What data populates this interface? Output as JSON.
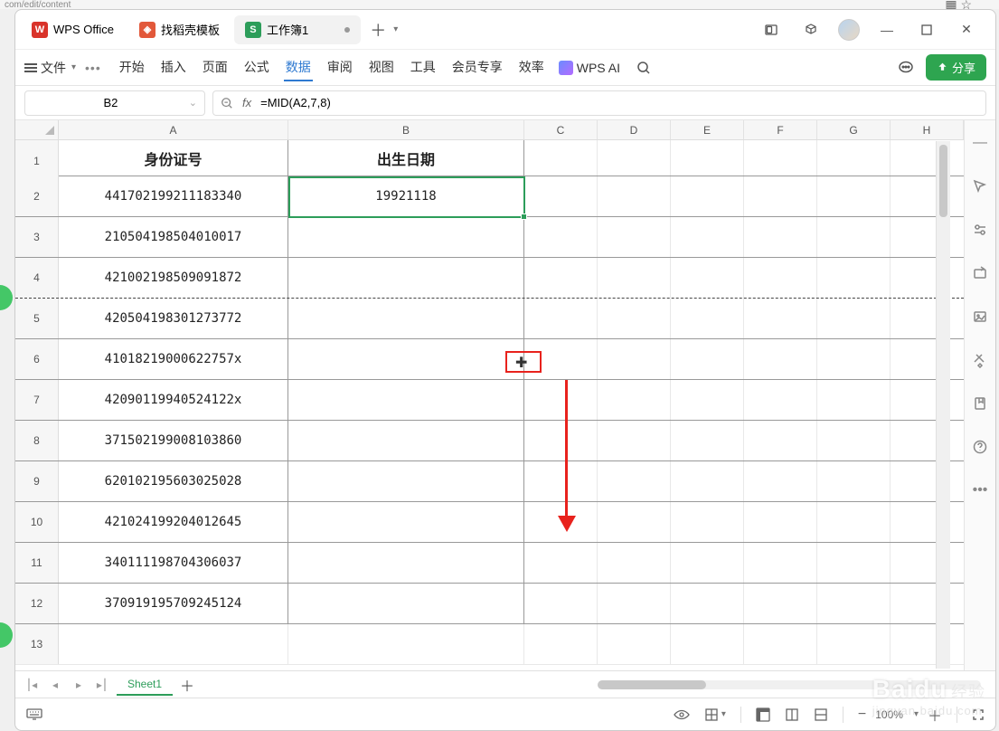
{
  "url_fragment": "com/edit/content",
  "tabs": {
    "wps": "WPS Office",
    "dao": "找稻壳模板",
    "workbook": "工作簿1"
  },
  "menubar": {
    "file": "文件",
    "items": [
      "开始",
      "插入",
      "页面",
      "公式",
      "数据",
      "审阅",
      "视图",
      "工具",
      "会员专享",
      "效率"
    ],
    "active_index": 4,
    "ai": "WPS AI",
    "share": "分享"
  },
  "name_box": "B2",
  "formula": "=MID(A2,7,8)",
  "columns": [
    "A",
    "B",
    "C",
    "D",
    "E",
    "F",
    "G",
    "H"
  ],
  "headers": {
    "A": "身份证号",
    "B": "出生日期"
  },
  "rows": [
    {
      "n": 1,
      "A": "身份证号",
      "B": "出生日期",
      "is_header": true
    },
    {
      "n": 2,
      "A": "441702199211183340",
      "B": "19921118"
    },
    {
      "n": 3,
      "A": "210504198504010017",
      "B": ""
    },
    {
      "n": 4,
      "A": "421002198509091872",
      "B": ""
    },
    {
      "n": 5,
      "A": "420504198301273772",
      "B": ""
    },
    {
      "n": 6,
      "A": "41018219000622757x",
      "B": ""
    },
    {
      "n": 7,
      "A": "42090119940524122x",
      "B": ""
    },
    {
      "n": 8,
      "A": "371502199008103860",
      "B": ""
    },
    {
      "n": 9,
      "A": "620102195603025028",
      "B": ""
    },
    {
      "n": 10,
      "A": "421024199204012645",
      "B": ""
    },
    {
      "n": 11,
      "A": "340111198704306037",
      "B": ""
    },
    {
      "n": 12,
      "A": "370919195709245124",
      "B": ""
    },
    {
      "n": 13,
      "A": "",
      "B": ""
    }
  ],
  "sheet_name": "Sheet1",
  "zoom": "100%",
  "watermark": {
    "logo": "Baidu",
    "cn": "经验",
    "sub": "jingyan.baidu.com"
  }
}
